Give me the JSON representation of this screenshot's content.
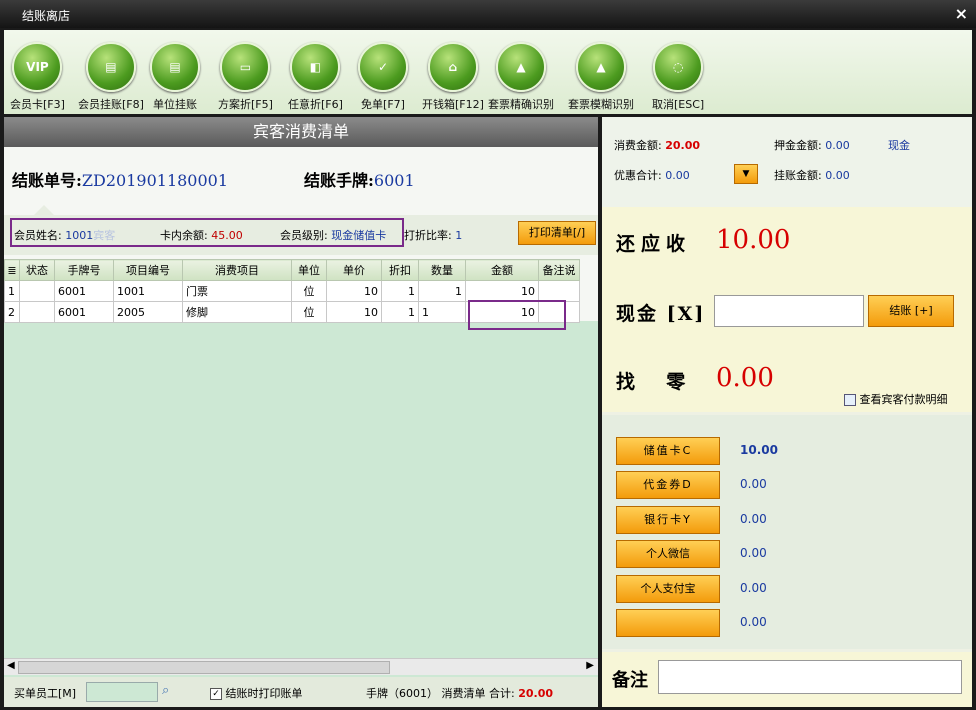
{
  "window": {
    "title": "结账离店",
    "close": "×"
  },
  "toolbar": [
    {
      "label": "会员卡[F3]",
      "icon": "VIP"
    },
    {
      "label": "会员挂账[F8]",
      "icon": "▤"
    },
    {
      "label": "单位挂账",
      "icon": "▤"
    },
    {
      "label": "方案折[F5]",
      "icon": "▭"
    },
    {
      "label": "任意折[F6]",
      "icon": "◧"
    },
    {
      "label": "免单[F7]",
      "icon": "✓"
    },
    {
      "label": "开钱箱[F12]",
      "icon": "⌂"
    },
    {
      "label": "套票精确识别",
      "icon": "▲"
    },
    {
      "label": "套票模糊识别",
      "icon": "▲"
    },
    {
      "label": "取消[ESC]",
      "icon": "◌"
    }
  ],
  "list": {
    "header": "宾客消费清单",
    "bill_no_label": "结账单号:",
    "bill_no": "ZD201901180001",
    "plate_label": "结账手牌:",
    "plate": "6001"
  },
  "member": {
    "name_label": "会员姓名:",
    "name_value": "1001",
    "name_faded": "宾客",
    "balance_label": "卡内余额:",
    "balance_value": "45.00",
    "level_label": "会员级别:",
    "level_value": "现金储值卡",
    "discount_label": "打折比率:",
    "discount_value": "1",
    "print_button": "打印清单[/]"
  },
  "table": {
    "columns": [
      "≣",
      "状态",
      "手牌号",
      "项目编号",
      "消费项目",
      "单位",
      "单价",
      "折扣",
      "数量",
      "金额",
      "备注说"
    ],
    "rows": [
      [
        "1",
        "",
        "6001",
        "1001",
        "门票",
        "位",
        "10",
        "1",
        "1",
        "10",
        ""
      ],
      [
        "2",
        "",
        "6001",
        "2005",
        "修脚",
        "位",
        "10",
        "1",
        "1",
        "10",
        ""
      ]
    ]
  },
  "footer": {
    "employee_label": "买单员工[M]",
    "print_checkbox_label": "结账时打印账单",
    "summary_label": "手牌（6001） 消费清单 合计:",
    "total": "20.00"
  },
  "summary": {
    "consume_label": "消费金额:",
    "consume_value": "20.00",
    "deposit_label": "押金金额:",
    "deposit_value": "0.00",
    "deposit_type": "现金",
    "discount_label": "优惠合计:",
    "discount_value": "0.00",
    "hang_label": "挂账金额:",
    "hang_value": "0.00"
  },
  "due": {
    "receivable_label": "还应收",
    "receivable_value": "10.00",
    "cash_label": "现金 [X]",
    "pay_button": "结账 [+]",
    "change_label": "找  零",
    "change_value": "0.00",
    "detail_label": "查看宾客付款明细"
  },
  "methods": [
    {
      "label": "储值卡C",
      "value": "10.00"
    },
    {
      "label": "代金券D",
      "value": "0.00"
    },
    {
      "label": "银行卡Y",
      "value": "0.00"
    },
    {
      "label": "个人微信",
      "value": "0.00"
    },
    {
      "label": "个人支付宝",
      "value": "0.00"
    },
    {
      "label": "",
      "value": "0.00"
    }
  ],
  "remark": {
    "label": "备注"
  }
}
